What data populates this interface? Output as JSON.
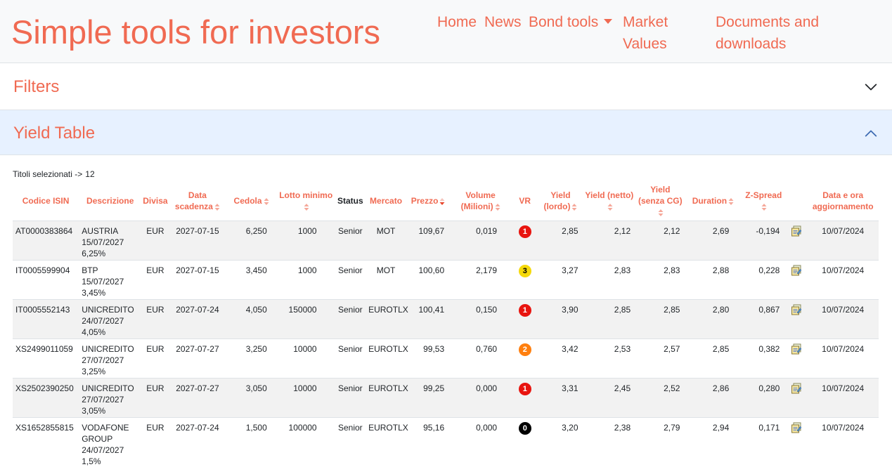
{
  "navbar": {
    "brand": "Simple tools for investors",
    "links": [
      {
        "label": "Home"
      },
      {
        "label": "News"
      },
      {
        "label": "Bond tools"
      },
      {
        "label": "Market Values"
      },
      {
        "label": "Documents and downloads"
      }
    ]
  },
  "accordion": {
    "filters": {
      "title": "Filters"
    },
    "yield_table": {
      "title": "Yield Table"
    }
  },
  "selection": {
    "label": "Titoli selezionati ->",
    "count": "12"
  },
  "colors": {
    "accent": "#f06a52",
    "vr1": "#e8140f",
    "vr2": "#ff7f0e",
    "vr3": "#f5d90a",
    "vr0": "#000000"
  },
  "table": {
    "headers": {
      "isin": "Codice ISIN",
      "descrizione": "Descrizione",
      "divisa": "Divisa",
      "scadenza": "Data scadenza",
      "cedola": "Cedola",
      "lotto": "Lotto minimo",
      "status": "Status",
      "mercato": "Mercato",
      "prezzo": "Prezzo",
      "volume": "Volume (Milioni)",
      "vr": "VR",
      "yield_lordo": "Yield (lordo)",
      "yield_netto": "Yield (netto)",
      "yield_senza_cg": "Yield (senza CG)",
      "duration": "Duration",
      "zspread": "Z-Spread",
      "aggiornamento": "Data e ora aggiornamento"
    },
    "rows": [
      {
        "isin": "AT0000383864",
        "descrizione": "AUSTRIA 15/07/2027 6,25%",
        "divisa": "EUR",
        "scadenza": "2027-07-15",
        "cedola": "6,250",
        "lotto": "1000",
        "status": "Senior",
        "mercato": "MOT",
        "prezzo": "109,67",
        "volume": "0,019",
        "vr": "1",
        "yield_lordo": "2,85",
        "yield_netto": "2,12",
        "yield_senza_cg": "2,12",
        "duration": "2,69",
        "zspread": "-0,194",
        "aggiornamento": "10/07/2024"
      },
      {
        "isin": "IT0005599904",
        "descrizione": "BTP 15/07/2027 3,45%",
        "divisa": "EUR",
        "scadenza": "2027-07-15",
        "cedola": "3,450",
        "lotto": "1000",
        "status": "Senior",
        "mercato": "MOT",
        "prezzo": "100,60",
        "volume": "2,179",
        "vr": "3",
        "yield_lordo": "3,27",
        "yield_netto": "2,83",
        "yield_senza_cg": "2,83",
        "duration": "2,88",
        "zspread": "0,228",
        "aggiornamento": "10/07/2024"
      },
      {
        "isin": "IT0005552143",
        "descrizione": "UNICREDITO 24/07/2027 4,05%",
        "divisa": "EUR",
        "scadenza": "2027-07-24",
        "cedola": "4,050",
        "lotto": "150000",
        "status": "Senior",
        "mercato": "EUROTLX",
        "prezzo": "100,41",
        "volume": "0,150",
        "vr": "1",
        "yield_lordo": "3,90",
        "yield_netto": "2,85",
        "yield_senza_cg": "2,85",
        "duration": "2,80",
        "zspread": "0,867",
        "aggiornamento": "10/07/2024"
      },
      {
        "isin": "XS2499011059",
        "descrizione": "UNICREDITO 27/07/2027 3,25%",
        "divisa": "EUR",
        "scadenza": "2027-07-27",
        "cedola": "3,250",
        "lotto": "10000",
        "status": "Senior",
        "mercato": "EUROTLX",
        "prezzo": "99,53",
        "volume": "0,760",
        "vr": "2",
        "yield_lordo": "3,42",
        "yield_netto": "2,53",
        "yield_senza_cg": "2,57",
        "duration": "2,85",
        "zspread": "0,382",
        "aggiornamento": "10/07/2024"
      },
      {
        "isin": "XS2502390250",
        "descrizione": "UNICREDITO 27/07/2027 3,05%",
        "divisa": "EUR",
        "scadenza": "2027-07-27",
        "cedola": "3,050",
        "lotto": "10000",
        "status": "Senior",
        "mercato": "EUROTLX",
        "prezzo": "99,25",
        "volume": "0,000",
        "vr": "1",
        "yield_lordo": "3,31",
        "yield_netto": "2,45",
        "yield_senza_cg": "2,52",
        "duration": "2,86",
        "zspread": "0,280",
        "aggiornamento": "10/07/2024"
      },
      {
        "isin": "XS1652855815",
        "descrizione": "VODAFONE GROUP 24/07/2027 1,5%",
        "divisa": "EUR",
        "scadenza": "2027-07-24",
        "cedola": "1,500",
        "lotto": "100000",
        "status": "Senior",
        "mercato": "EUROTLX",
        "prezzo": "95,16",
        "volume": "0,000",
        "vr": "0",
        "yield_lordo": "3,20",
        "yield_netto": "2,38",
        "yield_senza_cg": "2,79",
        "duration": "2,94",
        "zspread": "0,171",
        "aggiornamento": "10/07/2024"
      }
    ]
  }
}
